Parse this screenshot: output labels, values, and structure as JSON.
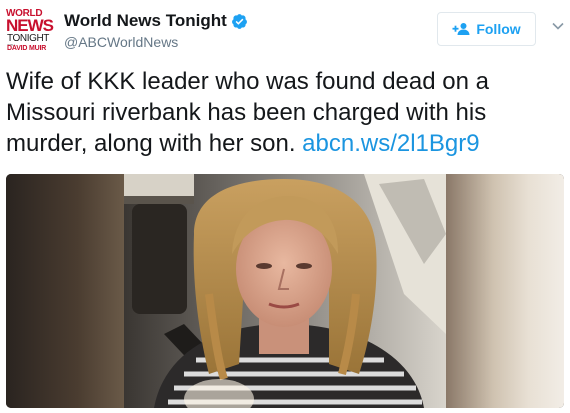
{
  "account": {
    "avatar_lines": [
      "WORLD",
      "NEWS",
      "TONIGHT",
      "WITH",
      "DAVID MUIR"
    ],
    "display_name": "World News Tonight",
    "handle": "@ABCWorldNews",
    "verified": true
  },
  "follow_button": {
    "label": "Follow",
    "icon": "add-user-icon"
  },
  "menu": {
    "icon": "chevron-down-icon"
  },
  "tweet": {
    "text": "Wife of KKK leader who was found dead on a Missouri riverbank has been charged with his murder, along with her son. ",
    "link": "abcn.ws/2l1Bgr9"
  },
  "colors": {
    "brand_blue": "#1da1f2",
    "link_blue": "#1b95e0",
    "handle_gray": "#657786",
    "logo_red": "#c8102e"
  }
}
